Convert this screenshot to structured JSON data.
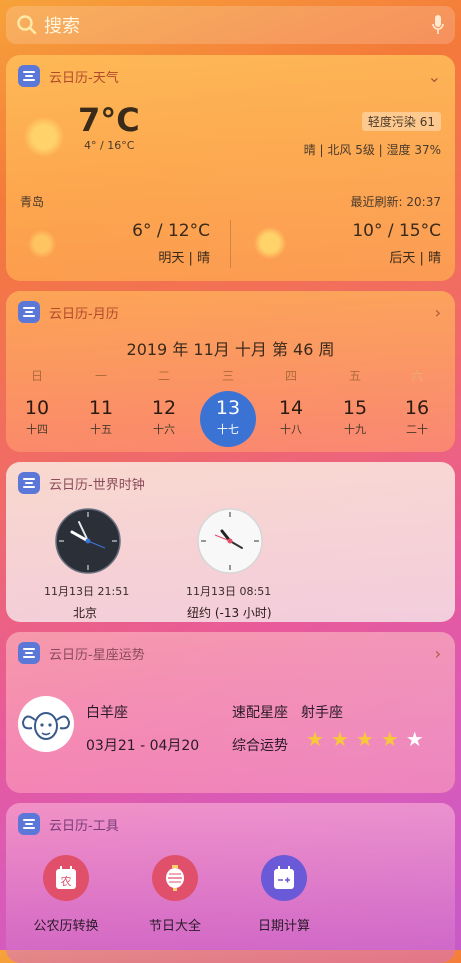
{
  "search": {
    "placeholder": "搜索",
    "icon": "search-icon",
    "mic_icon": "microphone-icon"
  },
  "weather": {
    "title": "云日历-天气",
    "temp": "7°C",
    "range": "4° / 16°C",
    "aqi": "轻度污染 61",
    "condition": "晴 | 北风 5级 | 湿度 37%",
    "city": "青岛",
    "refresh": "最近刷新: 20:37",
    "forecast": [
      {
        "temp": "6° / 12°C",
        "label": "明天 | 晴"
      },
      {
        "temp": "10° / 15°C",
        "label": "后天 | 晴"
      }
    ]
  },
  "calendar": {
    "title": "云日历-月历",
    "heading": "2019 年 11月  十月  第 46 周",
    "weekdays": [
      "日",
      "一",
      "二",
      "三",
      "四",
      "五",
      "六"
    ],
    "days": [
      {
        "day": "10",
        "lunar": "十四"
      },
      {
        "day": "11",
        "lunar": "十五"
      },
      {
        "day": "12",
        "lunar": "十六"
      },
      {
        "day": "13",
        "lunar": "十七",
        "today": true
      },
      {
        "day": "14",
        "lunar": "十八"
      },
      {
        "day": "15",
        "lunar": "十九"
      },
      {
        "day": "16",
        "lunar": "二十"
      }
    ],
    "accent": "#3a73d4"
  },
  "clock": {
    "title": "云日历-世界时钟",
    "clocks": [
      {
        "time": "11月13日 21:51",
        "city": "北京",
        "style": "dark"
      },
      {
        "time": "11月13日 08:51",
        "city": "纽约 (-13 小时)",
        "style": "light"
      }
    ]
  },
  "zodiac": {
    "title": "云日历-星座运势",
    "sign": "白羊座",
    "dates": "03月21 - 04月20",
    "match_label": "速配星座",
    "match_value": "射手座",
    "fortune_label": "综合运势",
    "rating": 4,
    "rating_max": 5
  },
  "tools": {
    "title": "云日历-工具",
    "items": [
      {
        "label": "公农历转换",
        "icon": "lunar-calendar-icon",
        "color": "#e0506a"
      },
      {
        "label": "节日大全",
        "icon": "lantern-icon",
        "color": "#e0506a"
      },
      {
        "label": "日期计算",
        "icon": "date-calculator-icon",
        "color": "#6a5ad8"
      }
    ]
  }
}
